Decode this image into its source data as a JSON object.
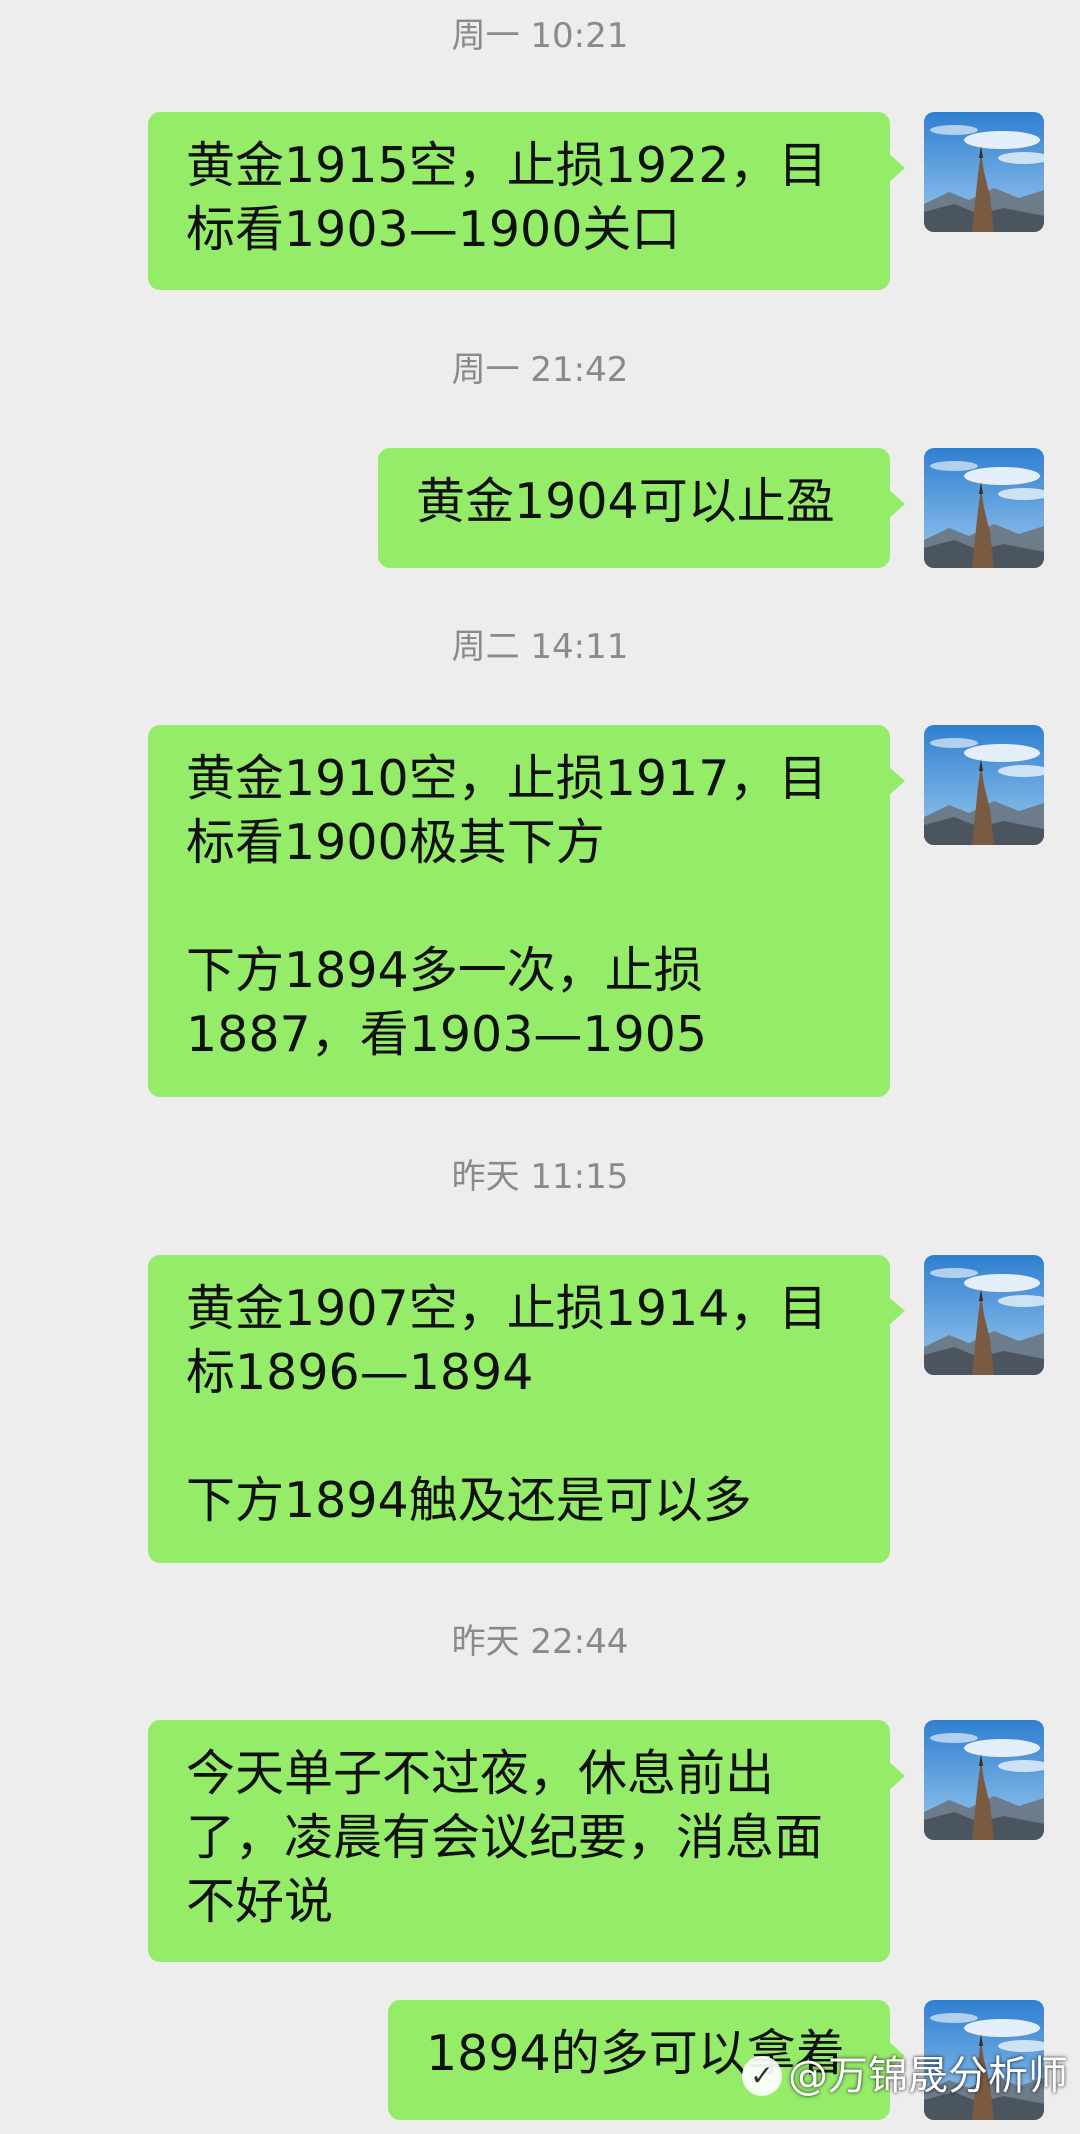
{
  "messages": [
    {
      "time": "周一 10:21",
      "text": "黄金1915空，止损1922，目标看1903—1900关口"
    },
    {
      "time": "周一 21:42",
      "text": "黄金1904可以止盈"
    },
    {
      "time": "周二 14:11",
      "text": "黄金1910空，止损1917，目标看1900极其下方\n\n下方1894多一次，止损1887，看1903—1905"
    },
    {
      "time": "昨天 11:15",
      "text": "黄金1907空，止损1914，目标1896—1894\n\n下方1894触及还是可以多"
    },
    {
      "time": "昨天 22:44",
      "text": "今天单子不过夜，休息前出了，凌晨有会议纪要，消息面不好说"
    },
    {
      "time": "",
      "text": "1894的多可以拿着"
    }
  ],
  "watermark": {
    "text": "@万锦晟分析师",
    "logo": "toutiao-logo-icon"
  },
  "colors": {
    "background": "#ededed",
    "bubble": "#95ec69",
    "timestamp": "#8a8a8a"
  }
}
